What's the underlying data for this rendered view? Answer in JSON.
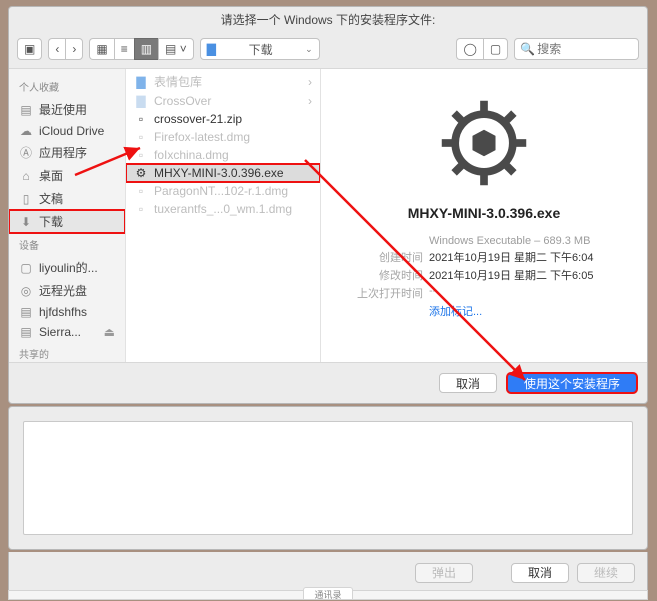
{
  "title": "请选择一个 Windows 下的安装程序文件:",
  "path_selector": {
    "folder_icon": "folder-icon",
    "label": "下载"
  },
  "search": {
    "placeholder": "搜索"
  },
  "sidebar": {
    "sections": [
      {
        "label": "个人收藏",
        "items": [
          {
            "icon": "clock-icon",
            "label": "最近使用"
          },
          {
            "icon": "cloud-icon",
            "label": "iCloud Drive"
          },
          {
            "icon": "app-icon",
            "label": "应用程序"
          },
          {
            "icon": "desktop-icon",
            "label": "桌面"
          },
          {
            "icon": "doc-icon",
            "label": "文稿"
          },
          {
            "icon": "download-icon",
            "label": "下载",
            "selected": true,
            "highlight": true
          }
        ]
      },
      {
        "label": "设备",
        "items": [
          {
            "icon": "computer-icon",
            "label": "liyoulin的..."
          },
          {
            "icon": "disc-icon",
            "label": "远程光盘"
          },
          {
            "icon": "drive-icon",
            "label": "hjfdshfhs"
          },
          {
            "icon": "drive-icon",
            "label": "Sierra...",
            "eject": true
          }
        ]
      },
      {
        "label": "共享的",
        "items": []
      }
    ]
  },
  "files": [
    {
      "icon": "folder-icon",
      "name": "表情包库",
      "enabled": false,
      "chevron": true
    },
    {
      "icon": "folder-icon",
      "name": "CrossOver",
      "enabled": false,
      "chevron": true
    },
    {
      "icon": "zip-icon",
      "name": "crossover-21.zip",
      "enabled": true
    },
    {
      "icon": "dmg-icon",
      "name": "Firefox-latest.dmg",
      "enabled": false
    },
    {
      "icon": "dmg-icon",
      "name": "foIxchina.dmg",
      "enabled": false
    },
    {
      "icon": "exe-icon",
      "name": "MHXY-MINI-3.0.396.exe",
      "enabled": true,
      "selected": true,
      "highlight": true
    },
    {
      "icon": "dmg-icon",
      "name": "ParagonNT...102-r.1.dmg",
      "enabled": false
    },
    {
      "icon": "dmg-icon",
      "name": "tuxerantfs_...0_wm.1.dmg",
      "enabled": false
    }
  ],
  "preview": {
    "filename": "MHXY-MINI-3.0.396.exe",
    "kind": "Windows Executable",
    "size": "689.3 MB",
    "rows": [
      {
        "k": "创建时间",
        "v": "2021年10月19日 星期二 下午6:04"
      },
      {
        "k": "修改时间",
        "v": "2021年10月19日 星期二 下午6:05"
      },
      {
        "k": "上次打开时间",
        "v": "--"
      }
    ],
    "add_tags": "添加标记..."
  },
  "footer": {
    "cancel": "取消",
    "confirm": "使用这个安装程序"
  },
  "panel2": {
    "eject": "弹出",
    "cancel": "取消",
    "continue": "继续"
  },
  "tab": "通讯录"
}
